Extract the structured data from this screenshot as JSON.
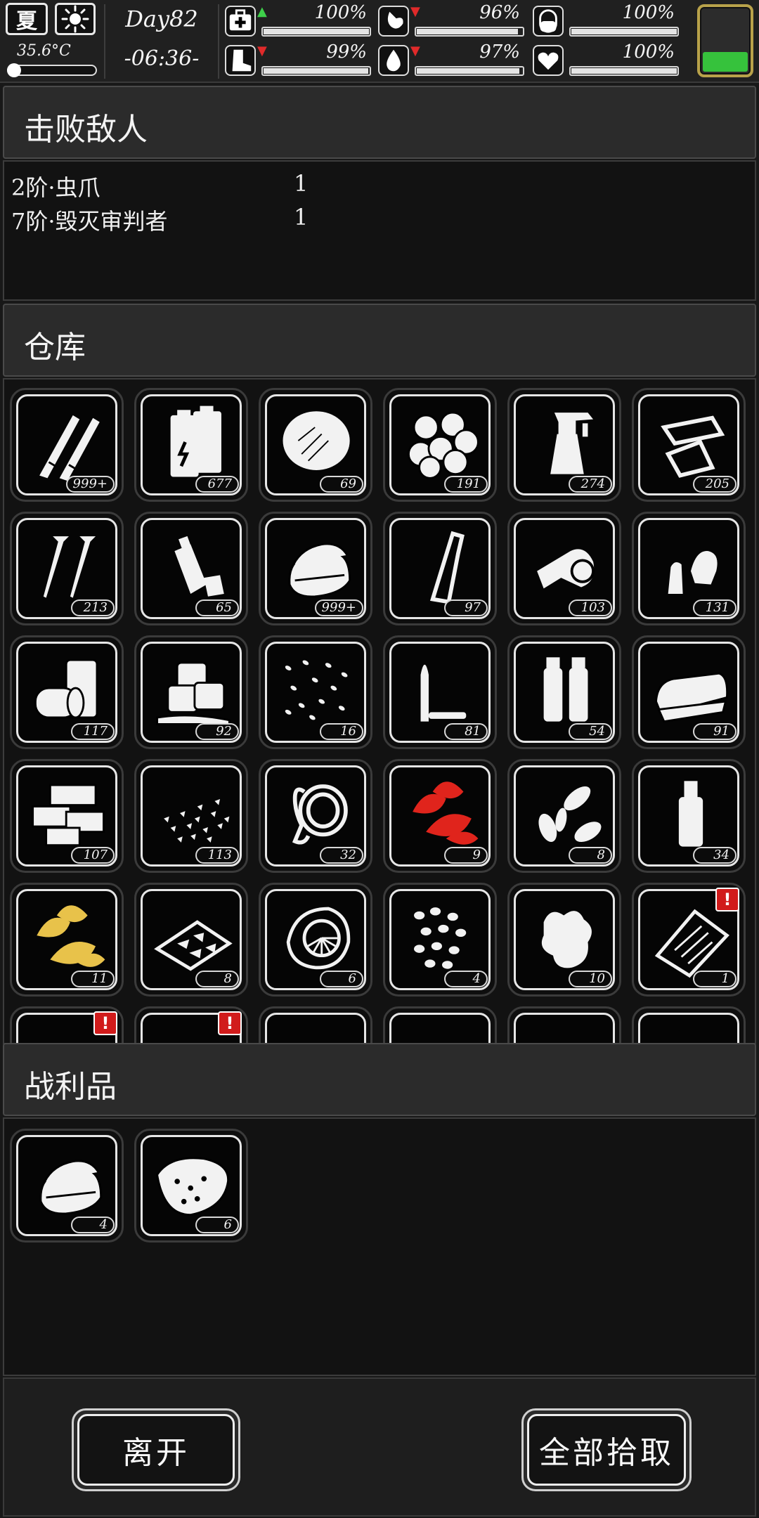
{
  "hud": {
    "season": "夏",
    "weather_icon": "sun-icon",
    "temperature": "35.6°C",
    "temperature_level": 0.12,
    "day": "Day82",
    "time": "-06:36-",
    "stats": [
      {
        "icon": "medkit-icon",
        "trend": "up",
        "value": "100%",
        "level": 1.0
      },
      {
        "icon": "stomach-icon",
        "trend": "down",
        "value": "96%",
        "level": 0.96
      },
      {
        "icon": "pill-icon",
        "trend": "none",
        "value": "100%",
        "level": 1.0
      },
      {
        "icon": "boot-icon",
        "trend": "down",
        "value": "99%",
        "level": 0.99
      },
      {
        "icon": "water-drop-icon",
        "trend": "down",
        "value": "97%",
        "level": 0.97
      },
      {
        "icon": "heart-icon",
        "trend": "none",
        "value": "100%",
        "level": 1.0
      }
    ],
    "battery_level": 0.3,
    "colors": {
      "trend_up": "#3ed04a",
      "trend_down": "#e02a2a",
      "battery": "#36c23c",
      "battery_frame": "#b8a24a"
    }
  },
  "defeated": {
    "title": "击败敌人",
    "enemies": [
      {
        "name": "2阶·虫爪",
        "count": "1"
      },
      {
        "name": "7阶·毁灭审判者",
        "count": "1"
      }
    ]
  },
  "storage": {
    "title": "仓库",
    "items": [
      {
        "icon": "bullets-icon",
        "count": "999+"
      },
      {
        "icon": "batteries-icon",
        "count": "677"
      },
      {
        "icon": "fiber-tuft-icon",
        "count": "69"
      },
      {
        "icon": "cotton-balls-icon",
        "count": "191"
      },
      {
        "icon": "spray-bottle-icon",
        "count": "274"
      },
      {
        "icon": "scrap-plates-icon",
        "count": "205"
      },
      {
        "icon": "screws-icon",
        "count": "213"
      },
      {
        "icon": "plastic-bottles-icon",
        "count": "65"
      },
      {
        "icon": "cloth-stack-icon",
        "count": "999+"
      },
      {
        "icon": "glass-bottle-icon",
        "count": "97"
      },
      {
        "icon": "bandage-roll-icon",
        "count": "103"
      },
      {
        "icon": "shell-casings-icon",
        "count": "131"
      },
      {
        "icon": "cans-icon",
        "count": "117"
      },
      {
        "icon": "ice-cubes-icon",
        "count": "92"
      },
      {
        "icon": "seeds-icon",
        "count": "16"
      },
      {
        "icon": "rifle-round-icon",
        "count": "81"
      },
      {
        "icon": "large-cartridges-icon",
        "count": "54"
      },
      {
        "icon": "folded-cloth-icon",
        "count": "91"
      },
      {
        "icon": "bricks-icon",
        "count": "107"
      },
      {
        "icon": "gravel-icon",
        "count": "113"
      },
      {
        "icon": "rope-icon",
        "count": "32"
      },
      {
        "icon": "red-herb-icon",
        "count": "9",
        "color": "#e0241c"
      },
      {
        "icon": "sunflower-seeds-icon",
        "count": "8"
      },
      {
        "icon": "medicine-bottle-icon",
        "count": "34"
      },
      {
        "icon": "yellow-herb-icon",
        "count": "11",
        "color": "#e8c24a"
      },
      {
        "icon": "jerky-tray-icon",
        "count": "8"
      },
      {
        "icon": "filter-mask-icon",
        "count": "6"
      },
      {
        "icon": "beans-icon",
        "count": "4"
      },
      {
        "icon": "ginger-root-icon",
        "count": "10"
      },
      {
        "icon": "clipboard-icon",
        "count": "1",
        "alert": true
      },
      {
        "icon": "book-icon",
        "count": "",
        "alert": true
      },
      {
        "icon": "note-icon",
        "count": "",
        "alert": true
      },
      {
        "icon": "partial-item-icon",
        "count": ""
      },
      {
        "icon": "partial-item-icon",
        "count": ""
      },
      {
        "icon": "partial-item-icon",
        "count": ""
      },
      {
        "icon": "partial-item-icon",
        "count": ""
      }
    ]
  },
  "loot": {
    "title": "战利品",
    "items": [
      {
        "icon": "cloth-stack-icon",
        "count": "4"
      },
      {
        "icon": "raw-meat-icon",
        "count": "6"
      }
    ]
  },
  "actions": {
    "leave_label": "离开",
    "take_all_label": "全部拾取"
  }
}
